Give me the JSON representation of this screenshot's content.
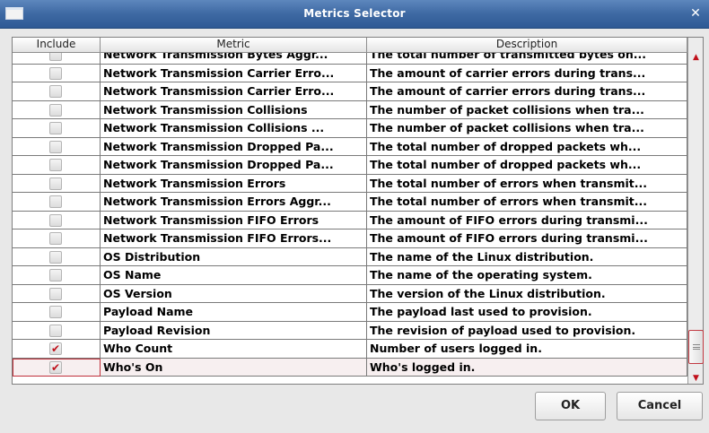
{
  "window": {
    "title": "Metrics Selector",
    "close_glyph": "✕"
  },
  "table": {
    "columns": [
      "Include",
      "Metric",
      "Description"
    ],
    "rows": [
      {
        "metric": "Network Transmission Bytes Aggr...",
        "description": "The total number of transmitted bytes on...",
        "include": false
      },
      {
        "metric": "Network Transmission Carrier Erro...",
        "description": "The amount of carrier errors during trans...",
        "include": false
      },
      {
        "metric": "Network Transmission Carrier Erro...",
        "description": "The amount of carrier errors during trans...",
        "include": false
      },
      {
        "metric": "Network Transmission Collisions",
        "description": "The number of packet collisions when tra...",
        "include": false
      },
      {
        "metric": "Network Transmission Collisions ...",
        "description": "The number of packet collisions when tra...",
        "include": false
      },
      {
        "metric": "Network Transmission Dropped Pa...",
        "description": "The total number of dropped packets wh...",
        "include": false
      },
      {
        "metric": "Network Transmission Dropped Pa...",
        "description": "The total number of dropped packets wh...",
        "include": false
      },
      {
        "metric": "Network Transmission Errors",
        "description": "The total number of errors when transmit...",
        "include": false
      },
      {
        "metric": "Network Transmission Errors Aggr...",
        "description": "The total number of errors when transmit...",
        "include": false
      },
      {
        "metric": "Network Transmission FIFO Errors",
        "description": "The amount of FIFO errors during transmi...",
        "include": false
      },
      {
        "metric": "Network Transmission FIFO Errors...",
        "description": "The amount of FIFO errors during transmi...",
        "include": false
      },
      {
        "metric": "OS Distribution",
        "description": "The name of the Linux distribution.",
        "include": false
      },
      {
        "metric": "OS Name",
        "description": "The name of the operating system.",
        "include": false
      },
      {
        "metric": "OS Version",
        "description": "The version of the Linux distribution.",
        "include": false
      },
      {
        "metric": "Payload Name",
        "description": "The payload last used to provision.",
        "include": false
      },
      {
        "metric": "Payload Revision",
        "description": "The revision of payload used to provision.",
        "include": false
      },
      {
        "metric": "Who Count",
        "description": "Number of users logged in.",
        "include": true
      },
      {
        "metric": "Who's On",
        "description": "Who's logged in.",
        "include": true,
        "selected": true
      }
    ],
    "check_glyph": "✔"
  },
  "scrollbar": {
    "up_glyph": "▲",
    "down_glyph": "▼"
  },
  "buttons": {
    "ok": "OK",
    "cancel": "Cancel"
  },
  "colors": {
    "titlebar": "#3e69a3",
    "accent": "#c0101a",
    "selected_row": "#f7eff0"
  }
}
